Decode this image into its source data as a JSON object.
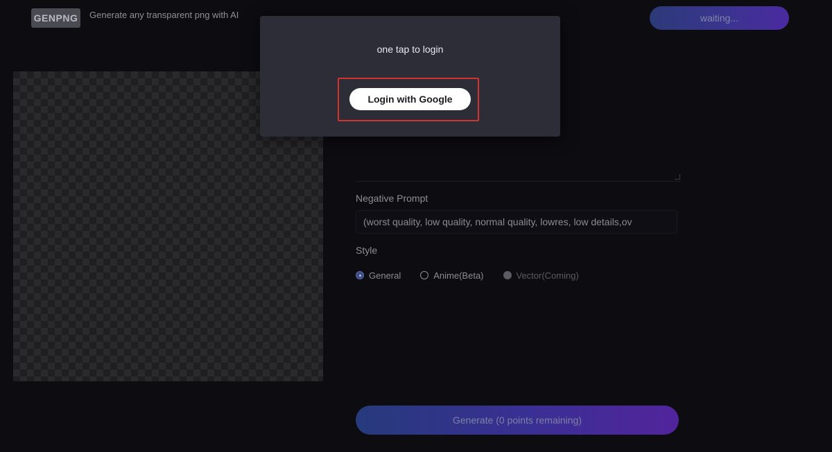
{
  "header": {
    "logo": "GENPNG",
    "tagline": "Generate any transparent png with AI",
    "status": "waiting..."
  },
  "modal": {
    "title": "one tap to login",
    "login_button": "Login with Google"
  },
  "form": {
    "negative_prompt_label": "Negative Prompt",
    "negative_prompt_value": "(worst quality, low quality, normal quality, lowres, low details,ov",
    "style_label": "Style",
    "styles": [
      {
        "label": "General",
        "state": "selected"
      },
      {
        "label": "Anime(Beta)",
        "state": "unselected"
      },
      {
        "label": "Vector(Coming)",
        "state": "disabled"
      }
    ],
    "generate_button": "Generate (0 points remaining)"
  },
  "colors": {
    "modal_bg": "#2d2d38",
    "highlight": "#d2332f",
    "gradient_start": "#263a7c",
    "gradient_end": "#52249c"
  }
}
